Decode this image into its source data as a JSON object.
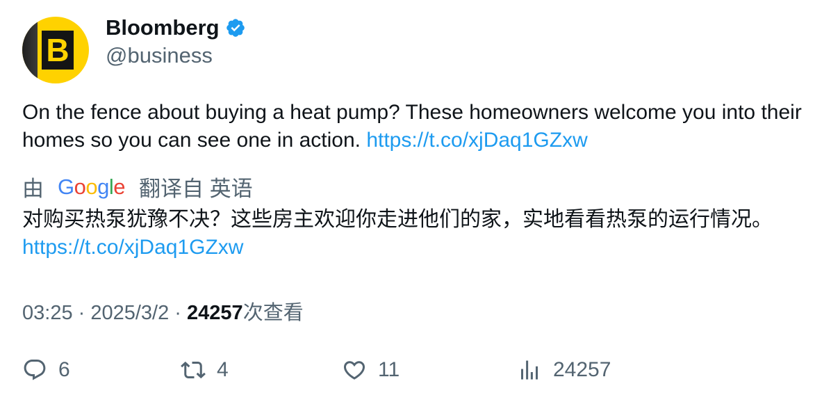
{
  "author": {
    "name": "Bloomberg",
    "handle": "@business",
    "avatar_letter": "B",
    "verified_color": "#1d9bf0"
  },
  "tweet": {
    "text": "On the fence about buying a heat pump? These homeowners welcome you into their homes so you can see one in action. ",
    "link": "https://t.co/xjDaq1GZxw"
  },
  "translation": {
    "prefix": "由",
    "provider_letters": [
      "G",
      "o",
      "o",
      "g",
      "l",
      "e"
    ],
    "suffix": "翻译自 英语",
    "text": "对购买热泵犹豫不决？这些房主欢迎你走进他们的家，实地看看热泵的运行情况。",
    "link": "https://t.co/xjDaq1GZxw"
  },
  "meta": {
    "time": "03:25",
    "sep1": " · ",
    "date": "2025/3/2",
    "sep2": " · ",
    "views": "24257",
    "views_label": "次查看"
  },
  "actions": {
    "replies": "6",
    "retweets": "4",
    "likes": "11",
    "views": "24257"
  },
  "icons": {
    "reply": "reply-icon",
    "retweet": "retweet-icon",
    "like": "heart-icon",
    "views": "analytics-icon"
  }
}
